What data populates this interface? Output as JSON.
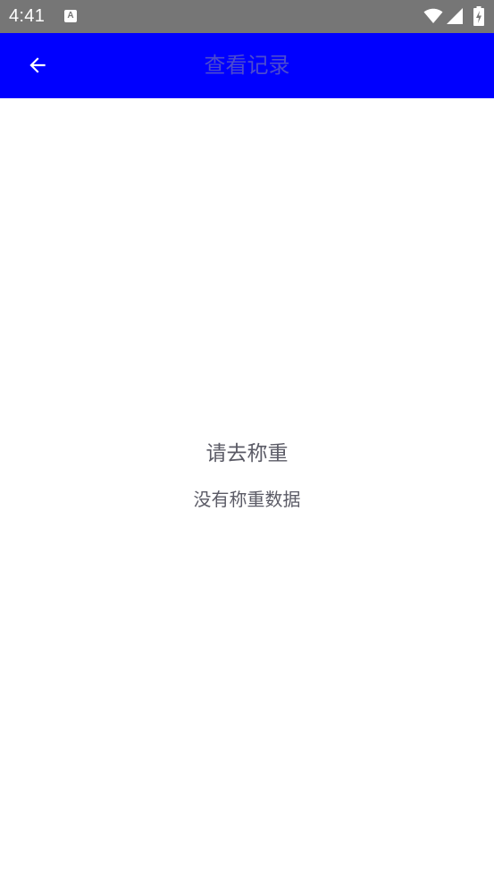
{
  "status_bar": {
    "time": "4:41",
    "notification_icon": "font-download-icon",
    "notification_glyph": "A",
    "wifi_icon": "wifi-icon",
    "signal_icon": "cell-signal-icon",
    "battery_icon": "battery-charging-icon"
  },
  "toolbar": {
    "title": "查看记录",
    "back_icon": "arrow-back-icon",
    "background_color": "#0000ff"
  },
  "empty_state": {
    "title": "请去称重",
    "subtitle": "没有称重数据"
  }
}
